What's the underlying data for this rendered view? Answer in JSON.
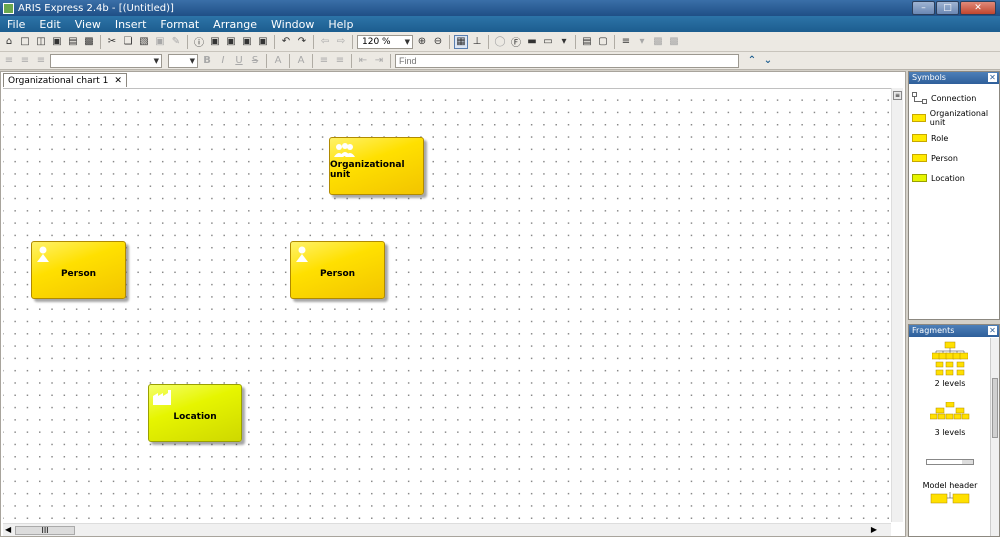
{
  "window": {
    "title": "ARIS Express 2.4b - [(Untitled)]",
    "controls": [
      "minimize",
      "maximize",
      "close"
    ]
  },
  "menu": [
    "File",
    "Edit",
    "View",
    "Insert",
    "Format",
    "Arrange",
    "Window",
    "Help"
  ],
  "toolbar": {
    "zoom_value": "120 %",
    "find_placeholder": "Find"
  },
  "document_tab": {
    "label": "Organizational chart 1",
    "close_glyph": "✕"
  },
  "canvas": {
    "shapes": [
      {
        "label": "Organizational unit",
        "icon": "organizational-unit-icon",
        "color": "#FFE000"
      },
      {
        "label": "Person",
        "icon": "person-icon",
        "color": "#FFE000"
      },
      {
        "label": "Person",
        "icon": "person-icon",
        "color": "#FFE000"
      },
      {
        "label": "Location",
        "icon": "location-icon",
        "color": "#E6F500"
      }
    ]
  },
  "symbols_panel": {
    "title": "Symbols",
    "items": [
      {
        "label": "Connection",
        "icon": "connection-icon"
      },
      {
        "label": "Organizational unit",
        "icon": "organizational-unit-swatch"
      },
      {
        "label": "Role",
        "icon": "role-swatch"
      },
      {
        "label": "Person",
        "icon": "person-swatch"
      },
      {
        "label": "Location",
        "icon": "location-swatch"
      }
    ]
  },
  "fragments_panel": {
    "title": "Fragments",
    "items": [
      {
        "label": "2 levels"
      },
      {
        "label": "3 levels"
      },
      {
        "label": "Model header"
      }
    ]
  },
  "scrollbar": {
    "thumb_glyph": "III"
  }
}
